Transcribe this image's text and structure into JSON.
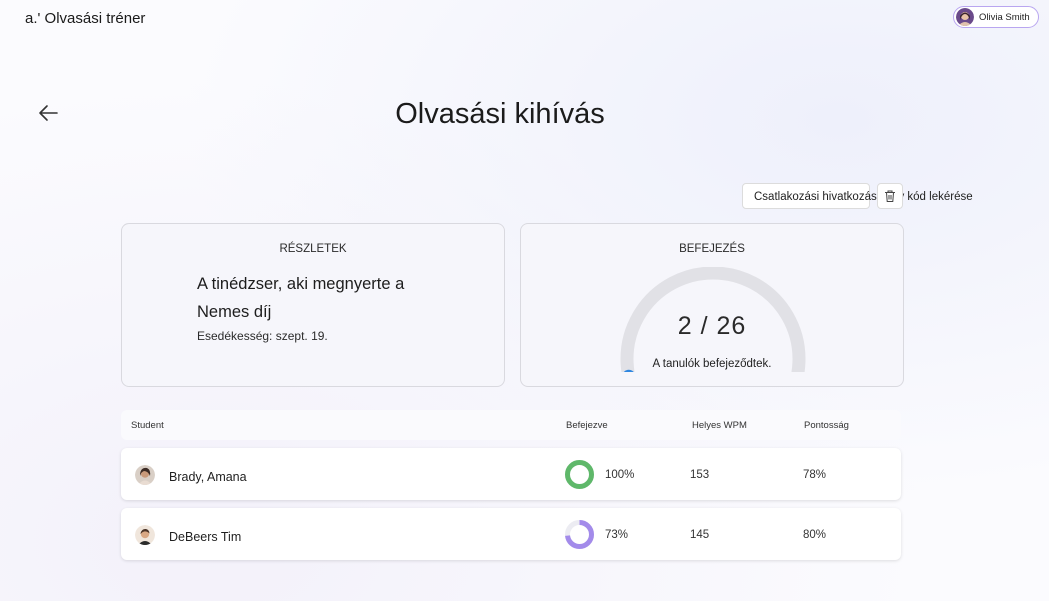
{
  "header": {
    "app_title": "a.' Olvasási tréner",
    "user_name": "Olivia Smith"
  },
  "page": {
    "title": "Olvasási kihívás",
    "join_button_label": "Csatlakozási hivatkozás vagy kód lekérése"
  },
  "details": {
    "heading": "RÉSZLETEK",
    "book_title": "A tinédzser, aki megnyerte a Nemes díj",
    "due": "Esedékesség: szept. 19."
  },
  "completion": {
    "heading": "BEFEJEZÉS",
    "value_text": "2 / 26",
    "completed": 2,
    "total": 26,
    "label": "A tanulók befejeződtek.",
    "accent_color": "#2f87e0",
    "track_color": "#e1e1e6"
  },
  "table": {
    "columns": [
      "Student",
      "Befejezve",
      "Helyes WPM",
      "Pontosság"
    ],
    "rows": [
      {
        "student": "Brady, Amana",
        "completed": "100%",
        "completed_fraction": 1.0,
        "ring_color": "#5fb86a",
        "wpm": "153",
        "accuracy": "78%"
      },
      {
        "student": "DeBeers Tim",
        "completed": "73%",
        "completed_fraction": 0.73,
        "ring_color": "#a38bea",
        "wpm": "145",
        "accuracy": "80%"
      }
    ]
  },
  "icons": {
    "back": "arrow-left-icon",
    "delete": "trash-icon"
  }
}
